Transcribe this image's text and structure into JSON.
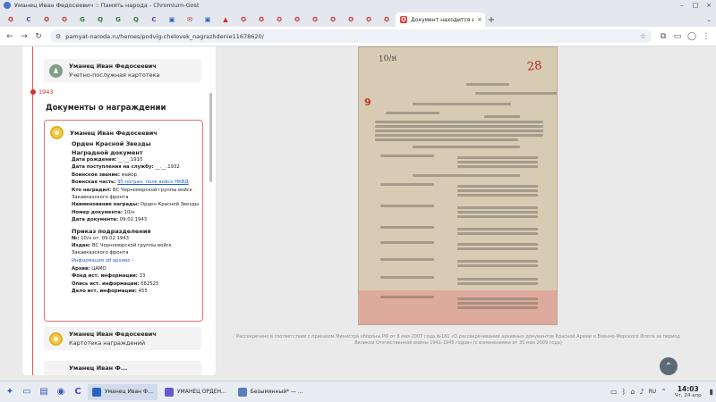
{
  "window": {
    "title": "Уманец Иван Федосеевич :: Память народа - Chromium-Gost"
  },
  "tabs": {
    "favicons": [
      {
        "glyph": "✪",
        "color": "#c62828"
      },
      {
        "glyph": "C",
        "color": "#5b3fd1"
      },
      {
        "glyph": "✪",
        "color": "#c62828"
      },
      {
        "glyph": "✪",
        "color": "#c62828"
      },
      {
        "glyph": "G",
        "color": "#2e7d32"
      },
      {
        "glyph": "Q",
        "color": "#2e7d32"
      },
      {
        "glyph": "G",
        "color": "#2e7d32"
      },
      {
        "glyph": "Q",
        "color": "#2e7d32"
      },
      {
        "glyph": "C",
        "color": "#5b3fd1"
      },
      {
        "glyph": "▣",
        "color": "#1e5fc7"
      },
      {
        "glyph": "✉",
        "color": "#c62828"
      },
      {
        "glyph": "▣",
        "color": "#1e5fc7"
      },
      {
        "glyph": "▲",
        "color": "#c62828"
      },
      {
        "glyph": "✪",
        "color": "#c62828"
      },
      {
        "glyph": "✪",
        "color": "#c62828"
      },
      {
        "glyph": "✪",
        "color": "#c62828"
      },
      {
        "glyph": "✪",
        "color": "#c62828"
      },
      {
        "glyph": "✪",
        "color": "#c62828"
      },
      {
        "glyph": "✪",
        "color": "#c62828"
      },
      {
        "glyph": "✪",
        "color": "#c62828"
      },
      {
        "glyph": "✪",
        "color": "#c62828"
      },
      {
        "glyph": "✪",
        "color": "#c62828"
      }
    ],
    "last_tab_label": "Документ находится в: ...",
    "last_tab_close": "×",
    "new_tab": "+"
  },
  "navbar": {
    "url": "pamyat-naroda.ru/heroes/podvig-chelovek_nagrazhdenie11678620/"
  },
  "timeline": {
    "year": "1943"
  },
  "cards": {
    "top": {
      "name": "Уманец Иван Федосеевич",
      "type": "Учетно-послужная картотека"
    },
    "bottom": {
      "name": "Уманец Иван Федосеевич",
      "type": "Картотека награждений"
    },
    "cut": {
      "name": "Уманец Иван Ф..."
    }
  },
  "section": {
    "title": "Документы о награждении"
  },
  "award": {
    "name": "Уманец Иван Федосеевич",
    "order": "Орден Красной Звезды",
    "doc_heading": "Наградной документ",
    "rows": [
      {
        "label": "Дата рождения:",
        "value": "__.__.1910"
      },
      {
        "label": "Дата поступления на службу:",
        "value": "__.__.1932"
      },
      {
        "label": "Воинское звание:",
        "value": "майор"
      },
      {
        "label": "Воинская часть:",
        "value": "95 погран. полк войск НКВД",
        "link": true
      },
      {
        "label": "Кто наградил:",
        "value": "ВС Черноморской группы войск Закавказского фронта"
      },
      {
        "label": "Наименование награды:",
        "value": "Орден Красной Звезды"
      },
      {
        "label": "Номер документа:",
        "value": "10/н"
      },
      {
        "label": "Дата документа:",
        "value": "09.02.1943"
      }
    ],
    "order_heading": "Приказ подразделения",
    "order_rows": [
      {
        "label": "№:",
        "value": "10/н от: 09.02.1943"
      },
      {
        "label": "Издан:",
        "value": "ВС Черноморской группы войск Закавказского фронта"
      }
    ],
    "archive_link": "Информация об архиве ›",
    "archive_rows": [
      {
        "label": "Архив:",
        "value": "ЦАМО"
      },
      {
        "label": "Фонд ист. информации:",
        "value": "33"
      },
      {
        "label": "Опись ист. информации:",
        "value": "682525"
      },
      {
        "label": "Дело ист. информации:",
        "value": "455"
      }
    ]
  },
  "document": {
    "handwritten": "10/н",
    "stamp": "28",
    "mark": "9"
  },
  "caption": "Рассекречено в соответствии с приказом Министра обороны РФ от 8 мая 2007 года №181 «О рассекречивании архивных документов Красной Армии и Военно-Морского Флота за период Великой Отечественной войны 1941-1945 годов» (с изменениями от 30 мая 2009 года)",
  "taskbar": {
    "tasks": [
      {
        "label": "Уманец Иван Ф...",
        "color": "#2962c4",
        "active": true
      },
      {
        "label": "УМАНЕЦ ОРДЕН...",
        "color": "#6a5acd",
        "active": false
      },
      {
        "label": "Безымянный* — ...",
        "color": "#5a7fbf",
        "active": false
      }
    ],
    "lang": "RU",
    "time": "14:03",
    "date": "Чт, 24 апр"
  }
}
